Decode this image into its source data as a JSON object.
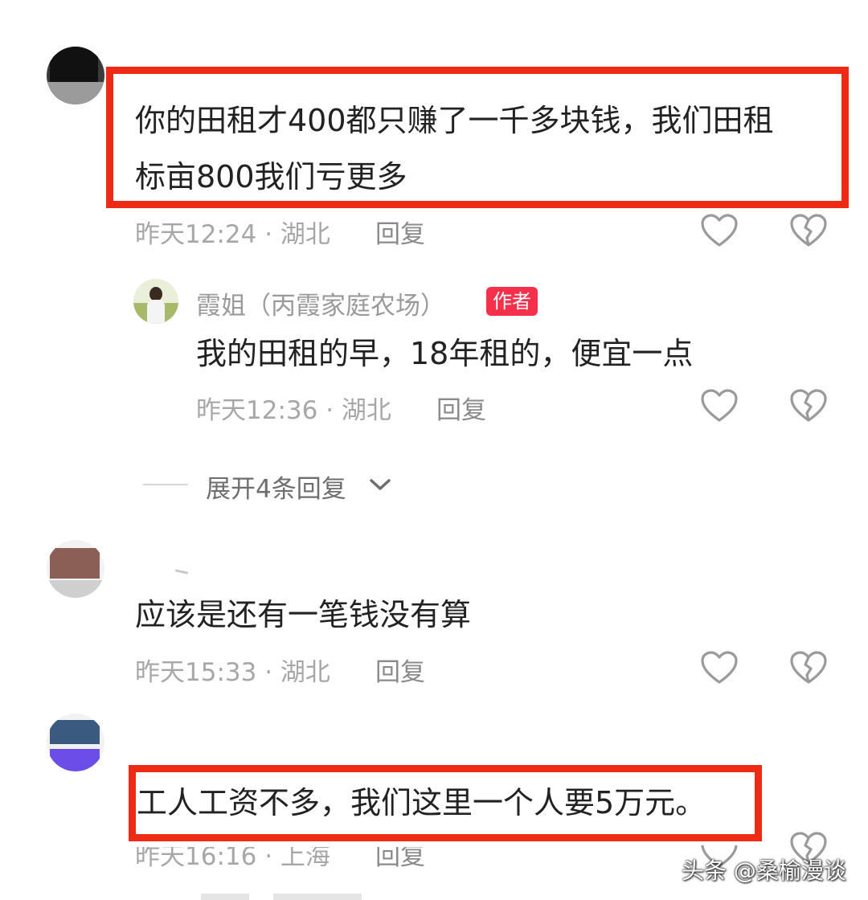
{
  "comments": [
    {
      "text_line1": "你的田租才400都只赚了一千多块钱，我们田租",
      "text_line2": "标亩800我们亏更多",
      "time": "昨天12:24",
      "location": "湖北",
      "reply_label": "回复"
    },
    {
      "text": "应该是还有一笔钱没有算",
      "time": "昨天15:33",
      "location": "湖北",
      "reply_label": "回复"
    },
    {
      "text": "工人工资不多，我们这里一个人要5万元。",
      "time": "昨天16:16",
      "location": "上海",
      "reply_label": "回复"
    }
  ],
  "reply": {
    "author_name": "霞姐（丙霞家庭农场）",
    "badge": "作者",
    "text": "我的田租的早，18年租的，便宜一点",
    "time": "昨天12:36",
    "location": "湖北",
    "reply_label": "回复"
  },
  "expand": {
    "label": "展开4条回复"
  },
  "watermark": "头条 @桑榆漫谈",
  "meta_separator": "·",
  "colors": {
    "highlight_box": "#ee2a14",
    "author_badge": "#f6304a",
    "meta_text": "#a7a7a7"
  },
  "icons": [
    "heart-outline-icon",
    "broken-heart-icon",
    "chevron-down-icon"
  ]
}
